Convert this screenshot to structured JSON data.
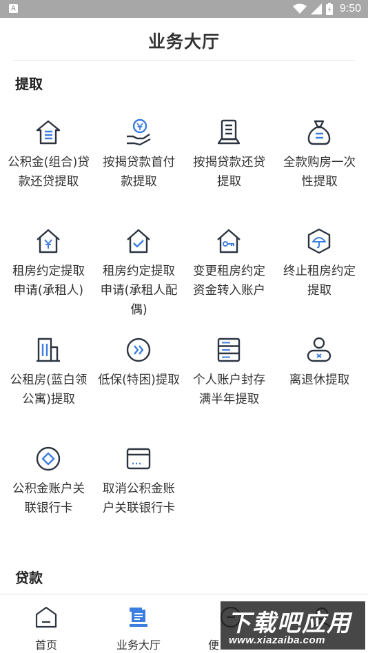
{
  "status_bar": {
    "time": "9:50"
  },
  "header": {
    "title": "业务大厅"
  },
  "sections": {
    "withdrawal": {
      "title": "提取",
      "items": [
        {
          "label": "公积金(组合)贷款还贷提取",
          "icon": "house-list-icon"
        },
        {
          "label": "按揭贷款首付款提取",
          "icon": "hand-coin-icon"
        },
        {
          "label": "按揭贷款还贷提取",
          "icon": "document-stand-icon"
        },
        {
          "label": "全款购房一次性提取",
          "icon": "money-bag-icon"
        },
        {
          "label": "租房约定提取申请(承租人)",
          "icon": "house-yen-icon"
        },
        {
          "label": "租房约定提取申请(承租人配偶)",
          "icon": "house-check-icon"
        },
        {
          "label": "变更租房约定资金转入账户",
          "icon": "house-key-icon"
        },
        {
          "label": "终止租房约定提取",
          "icon": "umbrella-hexagon-icon"
        },
        {
          "label": "公租房(蓝白领公寓)提取",
          "icon": "building-icon"
        },
        {
          "label": "低保(特困)提取",
          "icon": "double-chevron-circle-icon"
        },
        {
          "label": "个人账户封存满半年提取",
          "icon": "server-list-icon"
        },
        {
          "label": "离退休提取",
          "icon": "person-badge-icon"
        },
        {
          "label": "公积金账户关联银行卡",
          "icon": "circle-diamond-icon"
        },
        {
          "label": "取消公积金账户关联银行卡",
          "icon": "bank-card-icon"
        }
      ]
    },
    "loan": {
      "title": "贷款"
    }
  },
  "bottom_nav": [
    {
      "label": "首页",
      "icon": "home-icon",
      "active": false
    },
    {
      "label": "业务大厅",
      "icon": "hall-stack-icon",
      "active": true
    },
    {
      "label": "便",
      "icon": "convenience-icon",
      "active": false
    },
    {
      "label": "",
      "icon": "user-icon",
      "active": false
    }
  ],
  "watermark": {
    "big": "下载吧应用",
    "small": "www.xiazaiba.com"
  },
  "colors": {
    "accent": "#3b7de0",
    "icon_dark": "#2b3440",
    "status_bar": "#a7a7a7"
  }
}
